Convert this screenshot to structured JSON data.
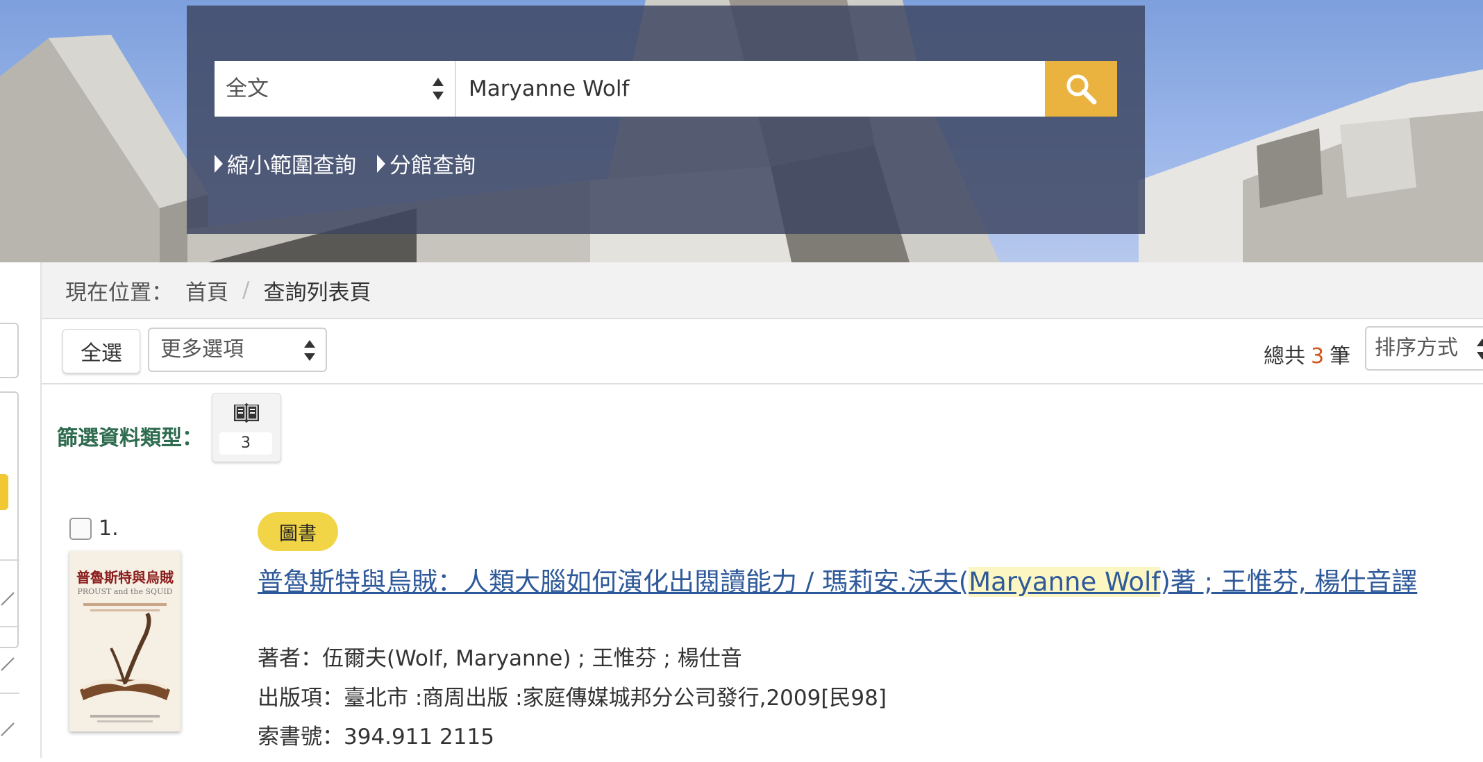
{
  "search": {
    "scope_value": "全文",
    "query": "Maryanne Wolf",
    "links": [
      "縮小範圍查詢",
      "分館查詢"
    ]
  },
  "breadcrumb": {
    "label": "現在位置：",
    "home": "首頁",
    "separator": "/",
    "current": "查詢列表頁"
  },
  "toolbar": {
    "select_all": "全選",
    "more_options": "更多選項",
    "total_prefix": "總共",
    "total_count": "3",
    "total_suffix": "筆",
    "sort_label": "排序方式"
  },
  "filter": {
    "label": "篩選資料類型：",
    "chip_icon": "book-icon",
    "chip_count": "3"
  },
  "results": [
    {
      "index": "1.",
      "badge": "圖書",
      "title_before": "普魯斯特與烏賊：人類大腦如何演化出閱讀能力 / 瑪莉安.沃夫(",
      "title_highlight": "Maryanne Wolf",
      "title_after": ")著 ; 王惟芬, 楊仕音譯",
      "author": "著者：伍爾夫(Wolf, Maryanne) ; 王惟芬 ; 楊仕音",
      "publication": "出版項：臺北市 :商周出版 :家庭傳媒城邦分公司發行,2009[民98]",
      "call_number": "索書號：394.911 2115",
      "cover": {
        "title": "普魯斯特與烏賊",
        "subtitle": "PROUST and the SQUID"
      }
    }
  ],
  "colors": {
    "search_button": "#eab33f",
    "panel": "#3e4662",
    "link": "#2f5a9a",
    "badge": "#f2d547",
    "count": "#d1541f",
    "filter_label": "#2e6b4f"
  }
}
